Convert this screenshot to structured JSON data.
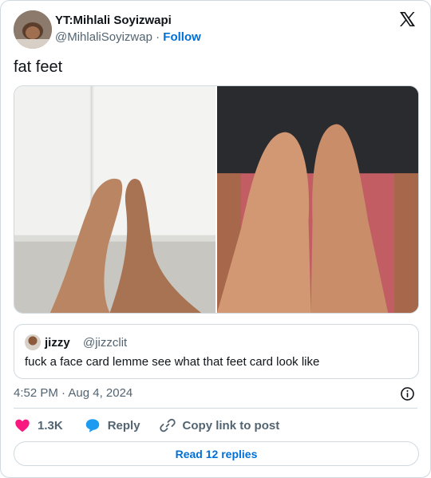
{
  "author": {
    "display_name": "YT:Mihlali Soyizwapi",
    "handle": "@MihlaliSoyizwap",
    "separator": "·",
    "follow_label": "Follow"
  },
  "tweet": {
    "text": "fat feet",
    "timestamp": "4:52 PM · Aug 4, 2024"
  },
  "quoted": {
    "name": "jizzy",
    "handle": "@jizzclit",
    "text": "fuck a face card lemme see what that feet card look like"
  },
  "actions": {
    "likes": "1.3K",
    "reply_label": "Reply",
    "copy_label": "Copy link to post"
  },
  "footer": {
    "read_replies_label": "Read 12 replies"
  },
  "colors": {
    "link": "#006fd6",
    "heart": "#f91880",
    "reply_bubble": "#1d9bf0",
    "secondary_text": "#536471",
    "border": "#cfd9de"
  },
  "icons": [
    "x-logo-icon",
    "info-icon",
    "heart-icon",
    "reply-icon",
    "link-icon"
  ]
}
